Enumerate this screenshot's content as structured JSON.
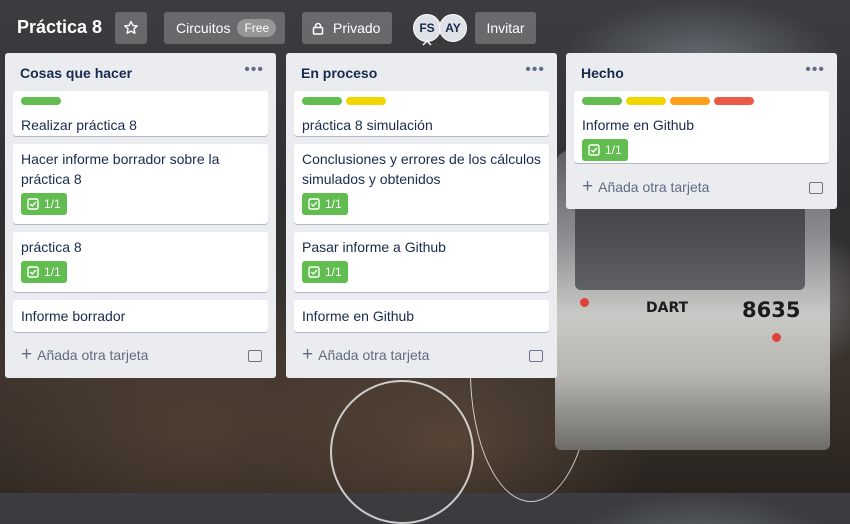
{
  "board": {
    "title": "Práctica 8",
    "workspace": "Circuitos",
    "plan": "Free",
    "visibility": "Privado",
    "invite": "Invitar"
  },
  "members": [
    {
      "initials": "FS"
    },
    {
      "initials": "AY"
    }
  ],
  "colors": {
    "green": "#61bd4f",
    "yellow": "#f2d600",
    "orange": "#ff9f1a",
    "red": "#eb5a46"
  },
  "add_card_label": "Añada otra tarjeta",
  "lists": [
    {
      "title": "Cosas que hacer",
      "cards": [
        {
          "title": "Realizar práctica 8",
          "labels": [
            "green"
          ]
        },
        {
          "title": "Hacer informe borrador sobre la práctica 8",
          "checklist": "1/1"
        },
        {
          "title": "práctica 8",
          "checklist": "1/1"
        },
        {
          "title": "Informe borrador"
        }
      ]
    },
    {
      "title": "En proceso",
      "cards": [
        {
          "title": "práctica 8 simulación",
          "labels": [
            "green",
            "yellow"
          ]
        },
        {
          "title": "Conclusiones y errores de los cálculos simulados y obtenidos",
          "checklist": "1/1"
        },
        {
          "title": "Pasar informe a Github",
          "checklist": "1/1"
        },
        {
          "title": "Informe en Github"
        }
      ]
    },
    {
      "title": "Hecho",
      "cards": [
        {
          "title": "Informe en Github",
          "labels": [
            "green",
            "yellow",
            "orange",
            "red"
          ],
          "checklist": "1/1"
        }
      ]
    }
  ],
  "background": {
    "train_number": "8635",
    "train_logo": "DART"
  }
}
